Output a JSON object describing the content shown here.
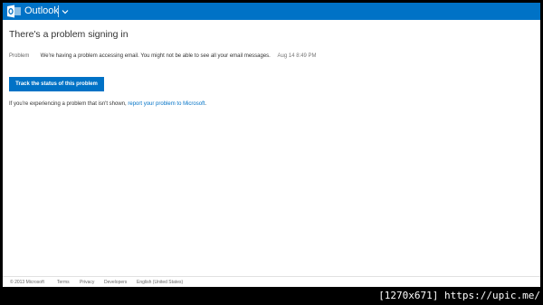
{
  "header": {
    "app_title": "Outlook",
    "logo_icon": "outlook-logo-icon",
    "menu_icon": "chevron-down-icon",
    "brand_color": "#0072c6"
  },
  "main": {
    "title": "There's a problem signing in",
    "problem": {
      "label": "Problem",
      "message": "We're having a problem accessing email. You might not be able to see all your email messages.",
      "timestamp": "Aug 14 8:49 PM"
    },
    "track_button_label": "Track the status of this problem",
    "report": {
      "prefix": "If you're experiencing a problem that isn't shown,",
      "link_text": "report your problem to Microsoft",
      "suffix": "."
    }
  },
  "footer": {
    "copyright": "© 2013 Microsoft",
    "links": [
      "Terms",
      "Privacy",
      "Developers",
      "English (United States)"
    ]
  },
  "watermark": "[1270x671] https://upic.me/"
}
